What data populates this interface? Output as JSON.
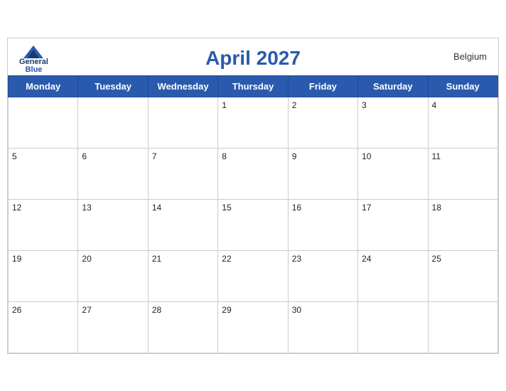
{
  "header": {
    "title": "April 2027",
    "country": "Belgium",
    "logo": {
      "line1": "General",
      "line2": "Blue"
    }
  },
  "weekdays": [
    "Monday",
    "Tuesday",
    "Wednesday",
    "Thursday",
    "Friday",
    "Saturday",
    "Sunday"
  ],
  "weeks": [
    [
      null,
      null,
      null,
      1,
      2,
      3,
      4
    ],
    [
      5,
      6,
      7,
      8,
      9,
      10,
      11
    ],
    [
      12,
      13,
      14,
      15,
      16,
      17,
      18
    ],
    [
      19,
      20,
      21,
      22,
      23,
      24,
      25
    ],
    [
      26,
      27,
      28,
      29,
      30,
      null,
      null
    ]
  ]
}
